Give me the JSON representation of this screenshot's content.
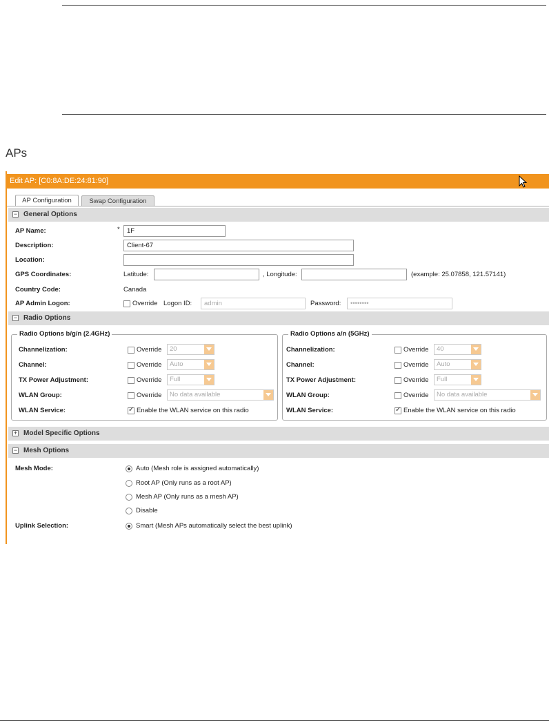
{
  "page": {
    "heading": "APs"
  },
  "panel": {
    "title": "Edit AP: [C0:8A:DE:24:81:90]"
  },
  "tabs": [
    {
      "label": "AP Configuration",
      "active": true
    },
    {
      "label": "Swap Configuration",
      "active": false
    }
  ],
  "general": {
    "band_label": "General Options",
    "ap_name_label": "AP Name:",
    "required_mark": "*",
    "ap_name_value": "1F",
    "description_label": "Description:",
    "description_value": "Client-67",
    "location_label": "Location:",
    "location_value": "",
    "gps_label": "GPS Coordinates:",
    "latitude_label": "Latitude:",
    "latitude_value": "",
    "longitude_label": ", Longitude:",
    "longitude_value": "",
    "gps_example": "(example: 25.07858, 121.57141)",
    "country_label": "Country Code:",
    "country_value": "Canada",
    "admin_label": "AP Admin Logon:",
    "override_label": "Override",
    "logon_id_label": "Logon ID:",
    "logon_id_value": "admin",
    "password_label": "Password:",
    "password_value": "••••••••"
  },
  "radio": {
    "band_label": "Radio Options",
    "left": {
      "legend": "Radio Options b/g/n (2.4GHz)",
      "channelization_label": "Channelization:",
      "channelization_value": "20",
      "channel_label": "Channel:",
      "channel_value": "Auto",
      "tx_label": "TX Power Adjustment:",
      "tx_value": "Full",
      "wlan_group_label": "WLAN Group:",
      "wlan_group_value": "No data available",
      "wlan_service_label": "WLAN Service:",
      "wlan_service_text": "Enable the WLAN service on this radio",
      "override_label": "Override"
    },
    "right": {
      "legend": "Radio Options a/n (5GHz)",
      "channelization_label": "Channelization:",
      "channelization_value": "40",
      "channel_label": "Channel:",
      "channel_value": "Auto",
      "tx_label": "TX Power Adjustment:",
      "tx_value": "Full",
      "wlan_group_label": "WLAN Group:",
      "wlan_group_value": "No data available",
      "wlan_service_label": "WLAN Service:",
      "wlan_service_text": "Enable the WLAN service on this radio",
      "override_label": "Override"
    }
  },
  "model": {
    "band_label": "Model Specific Options"
  },
  "mesh": {
    "band_label": "Mesh Options",
    "mode_label": "Mesh Mode:",
    "options": [
      {
        "label": "Auto (Mesh role is assigned automatically)",
        "selected": true
      },
      {
        "label": "Root AP (Only runs as a root AP)",
        "selected": false
      },
      {
        "label": "Mesh AP (Only runs as a mesh AP)",
        "selected": false
      },
      {
        "label": "Disable",
        "selected": false
      }
    ],
    "uplink_label": "Uplink Selection:",
    "uplink_option": "Smart (Mesh APs automatically select the best uplink)"
  }
}
